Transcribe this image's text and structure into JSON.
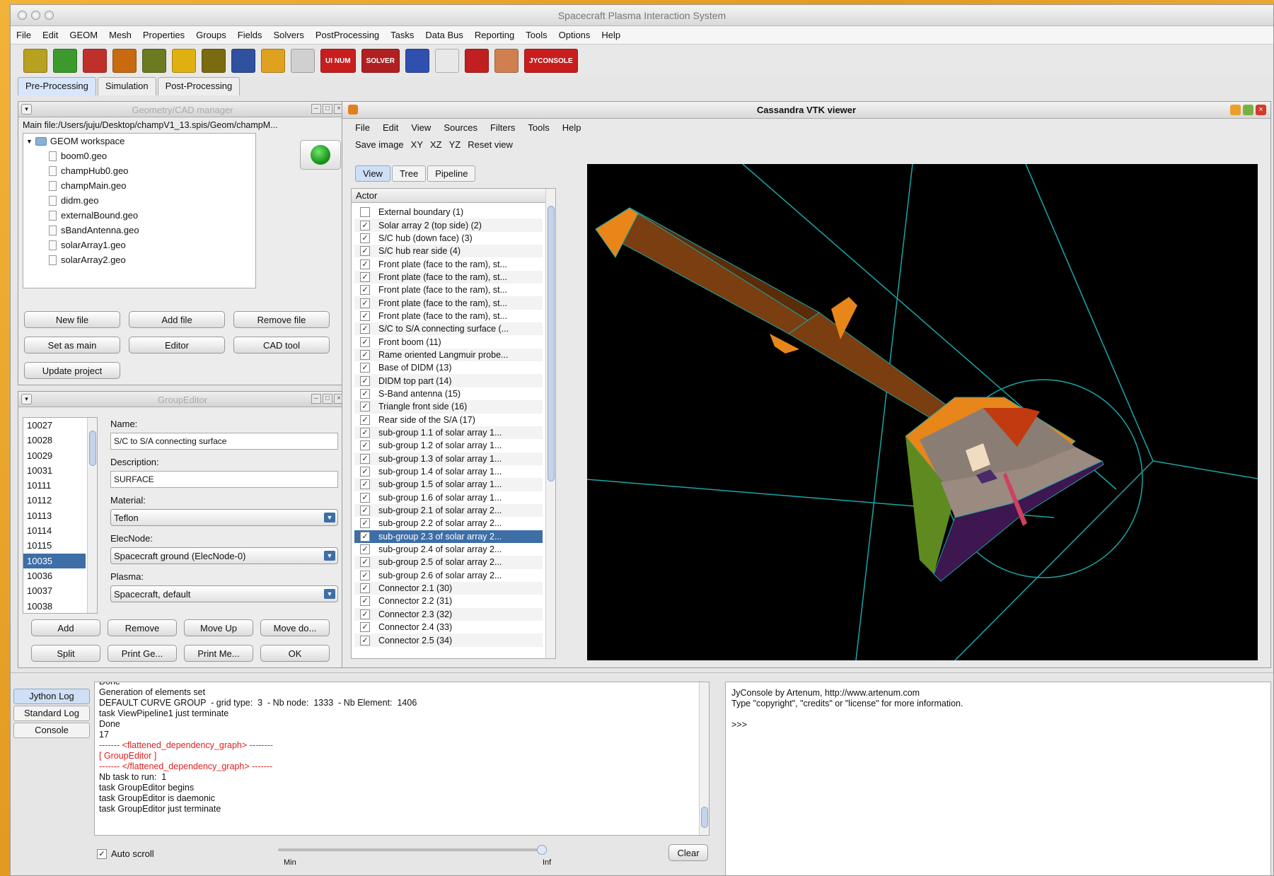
{
  "window": {
    "title": "Spacecraft Plasma Interaction System"
  },
  "menu": [
    "File",
    "Edit",
    "GEOM",
    "Mesh",
    "Properties",
    "Groups",
    "Fields",
    "Solvers",
    "PostProcessing",
    "Tasks",
    "Data Bus",
    "Reporting",
    "Tools",
    "Options",
    "Help"
  ],
  "toolbar_icons": [
    {
      "name": "import-geometry-icon",
      "label": "",
      "color": "#b8a020"
    },
    {
      "name": "import-mesh-icon",
      "label": "",
      "color": "#3c9a2c"
    },
    {
      "name": "cad-shapes-icon",
      "label": "",
      "color": "#c0302a"
    },
    {
      "name": "load-mesh-icon",
      "label": "",
      "color": "#c86a10"
    },
    {
      "name": "groups-icon",
      "label": "",
      "color": "#6c7a20"
    },
    {
      "name": "fields-icon",
      "label": "",
      "color": "#e0b010"
    },
    {
      "name": "grid-icon",
      "label": "",
      "color": "#7a6a10"
    },
    {
      "name": "properties-icon",
      "label": "",
      "color": "#3050a0"
    },
    {
      "name": "edit-pencil-icon",
      "label": "",
      "color": "#e0a020"
    },
    {
      "name": "global-params-icon",
      "label": "",
      "color": "#d0d0d0"
    },
    {
      "name": "ui-num-icon",
      "label": "UI NUM",
      "color": "#c81e1e"
    },
    {
      "name": "solver-icon",
      "label": "SOLVER",
      "color": "#b02020"
    },
    {
      "name": "simulation-icon",
      "label": "",
      "color": "#3050b0"
    },
    {
      "name": "plot-icon",
      "label": "",
      "color": "#e8e8e8"
    },
    {
      "name": "synoptic-icon",
      "label": "",
      "color": "#c02020"
    },
    {
      "name": "user-icon",
      "label": "",
      "color": "#d08050"
    },
    {
      "name": "jy-console-icon",
      "label": "JYCONSOLE",
      "color": "#c81e1e"
    }
  ],
  "perspective_tabs": [
    "Pre-Processing",
    "Simulation",
    "Post-Processing"
  ],
  "cad_manager": {
    "title": "Geometry/CAD manager",
    "main_file": "Main file:/Users/juju/Desktop/champV1_13.spis/Geom/champM...",
    "workspace": "GEOM workspace",
    "files": [
      "boom0.geo",
      "champHub0.geo",
      "champMain.geo",
      "didm.geo",
      "externalBound.geo",
      "sBandAntenna.geo",
      "solarArray1.geo",
      "solarArray2.geo"
    ],
    "buttons": [
      "New file",
      "Add file",
      "Remove file",
      "Set as main",
      "Editor",
      "CAD tool",
      "Update project"
    ]
  },
  "group_editor": {
    "title": "GroupEditor",
    "ids": [
      "10027",
      "10028",
      "10029",
      "10031",
      "10111",
      "10112",
      "10113",
      "10114",
      "10115",
      "10035",
      "10036",
      "10037",
      "10038"
    ],
    "selected_id": "10035",
    "labels": {
      "name": "Name:",
      "description": "Description:",
      "material": "Material:",
      "elecnode": "ElecNode:",
      "plasma": "Plasma:"
    },
    "name": "S/C to S/A connecting surface",
    "description": "SURFACE",
    "material": "Teflon",
    "elecnode": "Spacecraft ground (ElecNode-0)",
    "plasma": "Spacecraft, default",
    "buttons": [
      "Add",
      "Remove",
      "Move Up",
      "Move do...",
      "Split",
      "Print Ge...",
      "Print Me...",
      "OK"
    ]
  },
  "vtk": {
    "title": "Cassandra VTK viewer",
    "menu": [
      "File",
      "Edit",
      "View",
      "Sources",
      "Filters",
      "Tools",
      "Help"
    ],
    "toolbar": [
      "Save image",
      "XY",
      "XZ",
      "YZ",
      "Reset view"
    ],
    "tabs": [
      "View",
      "Tree",
      "Pipeline"
    ],
    "actor_header": "Actor",
    "actors": [
      {
        "label": "External boundary (1)",
        "checked": false
      },
      {
        "label": "Solar array 2 (top side) (2)",
        "checked": true
      },
      {
        "label": "S/C hub (down face) (3)",
        "checked": true
      },
      {
        "label": "S/C hub rear side  (4)",
        "checked": true
      },
      {
        "label": "Front plate (face to the ram), st...",
        "checked": true
      },
      {
        "label": "Front plate (face to the ram), st...",
        "checked": true
      },
      {
        "label": "Front plate (face to the ram), st...",
        "checked": true
      },
      {
        "label": "Front plate (face to the ram), st...",
        "checked": true
      },
      {
        "label": "Front plate (face to the ram), st...",
        "checked": true
      },
      {
        "label": "S/C to S/A connecting surface (...",
        "checked": true
      },
      {
        "label": "Front boom (11)",
        "checked": true
      },
      {
        "label": "Rame oriented Langmuir probe...",
        "checked": true
      },
      {
        "label": "Base of DIDM (13)",
        "checked": true
      },
      {
        "label": "DIDM top part (14)",
        "checked": true
      },
      {
        "label": "S-Band antenna (15)",
        "checked": true
      },
      {
        "label": "Triangle front side (16)",
        "checked": true
      },
      {
        "label": "Rear side of the S/A (17)",
        "checked": true
      },
      {
        "label": "sub-group 1.1 of solar array 1...",
        "checked": true
      },
      {
        "label": "sub-group 1.2 of solar array 1...",
        "checked": true
      },
      {
        "label": "sub-group 1.3 of solar array 1...",
        "checked": true
      },
      {
        "label": "sub-group 1.4 of solar array 1...",
        "checked": true
      },
      {
        "label": "sub-group 1.5 of solar array 1...",
        "checked": true
      },
      {
        "label": "sub-group 1.6 of solar array 1...",
        "checked": true
      },
      {
        "label": "sub-group 2.1 of solar array 2...",
        "checked": true
      },
      {
        "label": "sub-group 2.2 of solar array 2...",
        "checked": true
      },
      {
        "label": "sub-group 2.3 of solar array 2...",
        "checked": true,
        "selected": true
      },
      {
        "label": "sub-group 2.4 of solar array 2...",
        "checked": true
      },
      {
        "label": "sub-group 2.5 of solar array 2...",
        "checked": true
      },
      {
        "label": "sub-group 2.6 of solar array 2...",
        "checked": true
      },
      {
        "label": "Connector 2.1 (30)",
        "checked": true
      },
      {
        "label": "Connector 2.2 (31)",
        "checked": true
      },
      {
        "label": "Connector 2.3 (32)",
        "checked": true
      },
      {
        "label": "Connector 2.4 (33)",
        "checked": true
      },
      {
        "label": "Connector 2.5 (34)",
        "checked": true
      }
    ]
  },
  "log": {
    "tabs": [
      "Jython Log",
      "Standard Log",
      "Console"
    ],
    "lines": [
      {
        "text": "Done",
        "color": "#111"
      },
      {
        "text": "Generation of elements set",
        "color": "#111"
      },
      {
        "text": "DEFAULT CURVE GROUP  - grid type:  3  - Nb node:  1333  - Nb Element:  1406",
        "color": "#111"
      },
      {
        "text": "task ViewPipeline1 just terminate",
        "color": "#111"
      },
      {
        "text": "Done",
        "color": "#111"
      },
      {
        "text": "17",
        "color": "#111"
      },
      {
        "text": "------- <flattened_dependency_graph> --------",
        "color": "#e02020"
      },
      {
        "text": "[ GroupEditor ]",
        "color": "#e02020"
      },
      {
        "text": "------- </flattened_dependency_graph> -------",
        "color": "#e02020"
      },
      {
        "text": "Nb task to run:  1",
        "color": "#111"
      },
      {
        "text": "task GroupEditor begins",
        "color": "#111"
      },
      {
        "text": "task GroupEditor is daemonic",
        "color": "#111"
      },
      {
        "text": "task GroupEditor just terminate",
        "color": "#111"
      }
    ],
    "auto_scroll": "Auto scroll",
    "slider_min": "Min",
    "slider_max": "Inf",
    "clear": "Clear"
  },
  "jyconsole": {
    "lines": [
      "JyConsole by Artenum, http://www.artenum.com",
      "Type \"copyright\", \"credits\" or \"license\" for more information.",
      "",
      ">>>"
    ]
  }
}
